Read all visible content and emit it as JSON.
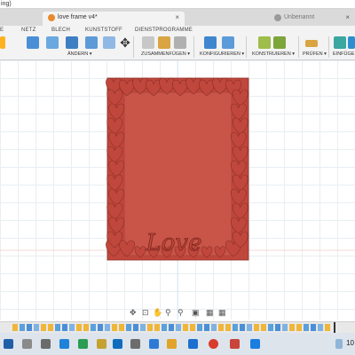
{
  "window": {
    "address_fragment": "ing)"
  },
  "tabs": [
    {
      "label": "love frame v4*",
      "close": "×"
    },
    {
      "label": "Unbenannt",
      "close": "×"
    }
  ],
  "ribbon": {
    "tabs": [
      "E",
      "NETZ",
      "BLECH",
      "KUNSTSTOFF",
      "DIENSTPROGRAMME"
    ],
    "groups": [
      "ÄNDERN ▾",
      "ZUSAMMENFÜGEN ▾",
      "KONFIGURIEREN ▾",
      "KONSTRUIEREN ▾",
      "PRÜFEN ▾",
      "EINFÜGE"
    ]
  },
  "model": {
    "engraving_text": "Love",
    "colors": {
      "frame": "#c0473c",
      "frame_dark": "#8e2f27",
      "inner": "#c85548",
      "grid": "#e8eef2",
      "axis_red": "#f2b3b3"
    }
  },
  "nav_bar": {
    "icons": [
      "orbit-icon",
      "pan-icon",
      "hand-icon",
      "zoom-icon",
      "zoom-window-icon",
      "display-mode-icon",
      "visual-style-icon",
      "grid-icon"
    ]
  },
  "taskbar": {
    "clock": "10"
  }
}
